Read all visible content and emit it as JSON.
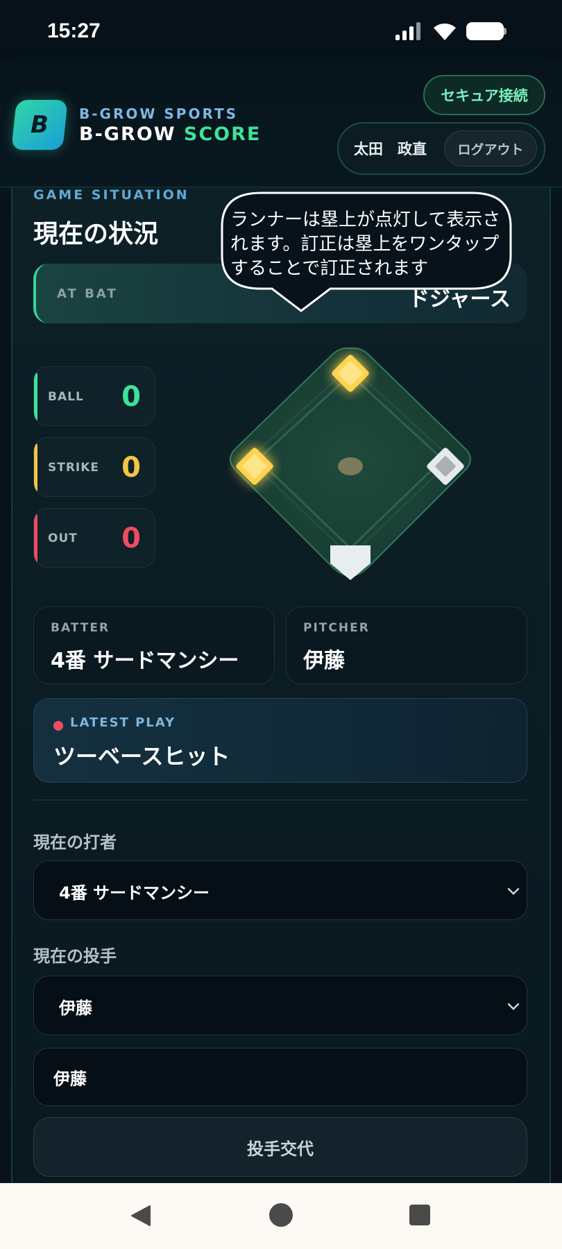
{
  "status_bar": {
    "time": "15:27"
  },
  "header": {
    "logo_letter": "B",
    "brand_sub": "B-GROW SPORTS",
    "brand_main": "B-GROW",
    "brand_accent": "SCORE",
    "secure_label": "セキュア接続",
    "user_name": "太田　政直",
    "logout_label": "ログアウト"
  },
  "situation": {
    "eyebrow": "GAME SITUATION",
    "title": "現在の状況",
    "at_bat_label": "AT BAT",
    "at_bat_team": "ドジャース",
    "callout": "ランナーは塁上が点灯して表示されます。訂正は塁上をワンタップすることで訂正されます"
  },
  "count": [
    {
      "label": "BALL",
      "value": "0",
      "color": "#3ee29a"
    },
    {
      "label": "STRIKE",
      "value": "0",
      "color": "#f4c542"
    },
    {
      "label": "OUT",
      "value": "0",
      "color": "#f04b63"
    }
  ],
  "bases": {
    "first": {
      "occupied": false,
      "icon": "base-empty"
    },
    "second": {
      "occupied": true,
      "icon": "base-lit"
    },
    "third": {
      "occupied": true,
      "icon": "base-lit"
    }
  },
  "batter_card": {
    "label": "BATTER",
    "value": "4番 サードマンシー"
  },
  "pitcher_card": {
    "label": "PITCHER",
    "value": "伊藤"
  },
  "latest_play": {
    "label": "LATEST PLAY",
    "value": "ツーベースヒット"
  },
  "form": {
    "batter_label": "現在の打者",
    "batter_selected": "4番 サードマンシー",
    "pitcher_label": "現在の投手",
    "pitcher_selected": "伊藤",
    "pitcher_input_value": "伊藤",
    "change_pitcher_label": "投手交代"
  },
  "colors": {
    "accent_green": "#3ee29a",
    "accent_blue": "#5fa9d6",
    "base_lit": "#ffd34d",
    "background": "#07121a"
  }
}
